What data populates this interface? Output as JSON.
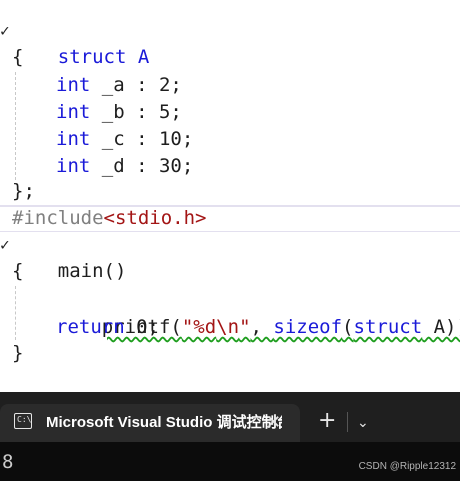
{
  "code": {
    "struct_line": {
      "fold": "✓",
      "kw": "struct",
      "name": " A"
    },
    "open_brace_1": "{",
    "fields": [
      {
        "kw": "int",
        "rest": " _a : 2;"
      },
      {
        "kw": "int",
        "rest": " _b : 5;"
      },
      {
        "kw": "int",
        "rest": " _c : 10;"
      },
      {
        "kw": "int",
        "rest": " _d : 30;"
      }
    ],
    "close_struct": "};",
    "include": {
      "directive": "#include",
      "header": "<stdio.h>"
    },
    "main_line": {
      "fold": "✓",
      "name": "main()"
    },
    "open_brace_2": "{",
    "printf_line": {
      "fn": "printf(",
      "str_open": "\"%d",
      "esc": "\\n",
      "str_close": "\"",
      "mid": ", ",
      "sizeof": "sizeof",
      "paren": "(",
      "struct_kw": "struct",
      "tail": " A));"
    },
    "return_line": {
      "kw": "return",
      "rest": " 0;"
    },
    "close_brace_2": "}"
  },
  "terminal": {
    "tab_title": "Microsoft Visual Studio 调试控制台",
    "tab_icon_text": "C:\\",
    "close_glyph": "✕",
    "new_tab_glyph": "+",
    "dropdown_glyph": "⌄",
    "output": "8",
    "watermark": "CSDN @Ripple12312"
  },
  "colors": {
    "keyword": "#1a1ad8",
    "string": "#a31515",
    "squiggle": "#1f9e1f",
    "terminal_bg": "#0c0c0c",
    "tabbar_bg": "#1f1f1f"
  }
}
